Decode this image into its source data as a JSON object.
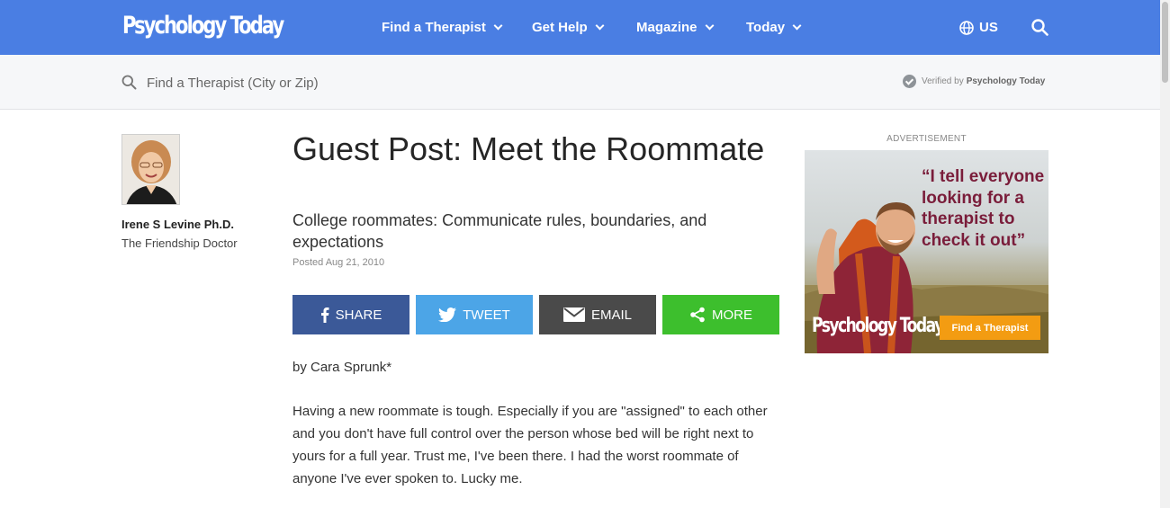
{
  "header": {
    "logo": "Psychology Today",
    "nav": [
      {
        "label": "Find a Therapist"
      },
      {
        "label": "Get Help"
      },
      {
        "label": "Magazine"
      },
      {
        "label": "Today"
      }
    ],
    "region": "US"
  },
  "search": {
    "placeholder": "Find a Therapist (City or Zip)",
    "verified_prefix": "Verified by",
    "verified_brand": "Psychology Today"
  },
  "author": {
    "name": "Irene S Levine Ph.D.",
    "title": "The Friendship Doctor"
  },
  "article": {
    "title": "Guest Post: Meet the Roommate",
    "subtitle": "College roommates: Communicate rules, boundaries, and expectations",
    "posted": "Posted Aug 21, 2010",
    "byline": "by Cara Sprunk*",
    "paragraph": "Having a new roommate is tough. Especially if you are \"assigned\" to each other and you don't have full control over the person whose bed will be right next to yours for a full year. Trust me, I've been there. I had the worst roommate of anyone I've ever spoken to. Lucky me."
  },
  "share": {
    "share": "SHARE",
    "tweet": "TWEET",
    "email": "EMAIL",
    "more": "MORE"
  },
  "ad": {
    "label": "ADVERTISEMENT",
    "quote": "“I tell everyone looking for a therapist to check it out”",
    "logo": "Psychology Today",
    "button": "Find a Therapist"
  },
  "colors": {
    "header": "#4a7ee3",
    "facebook": "#3b5998",
    "twitter": "#4ca5e7",
    "email": "#4a4a4a",
    "more": "#3dbf2d",
    "ad_button": "#f39c12",
    "ad_quote": "#7a1d3a"
  }
}
